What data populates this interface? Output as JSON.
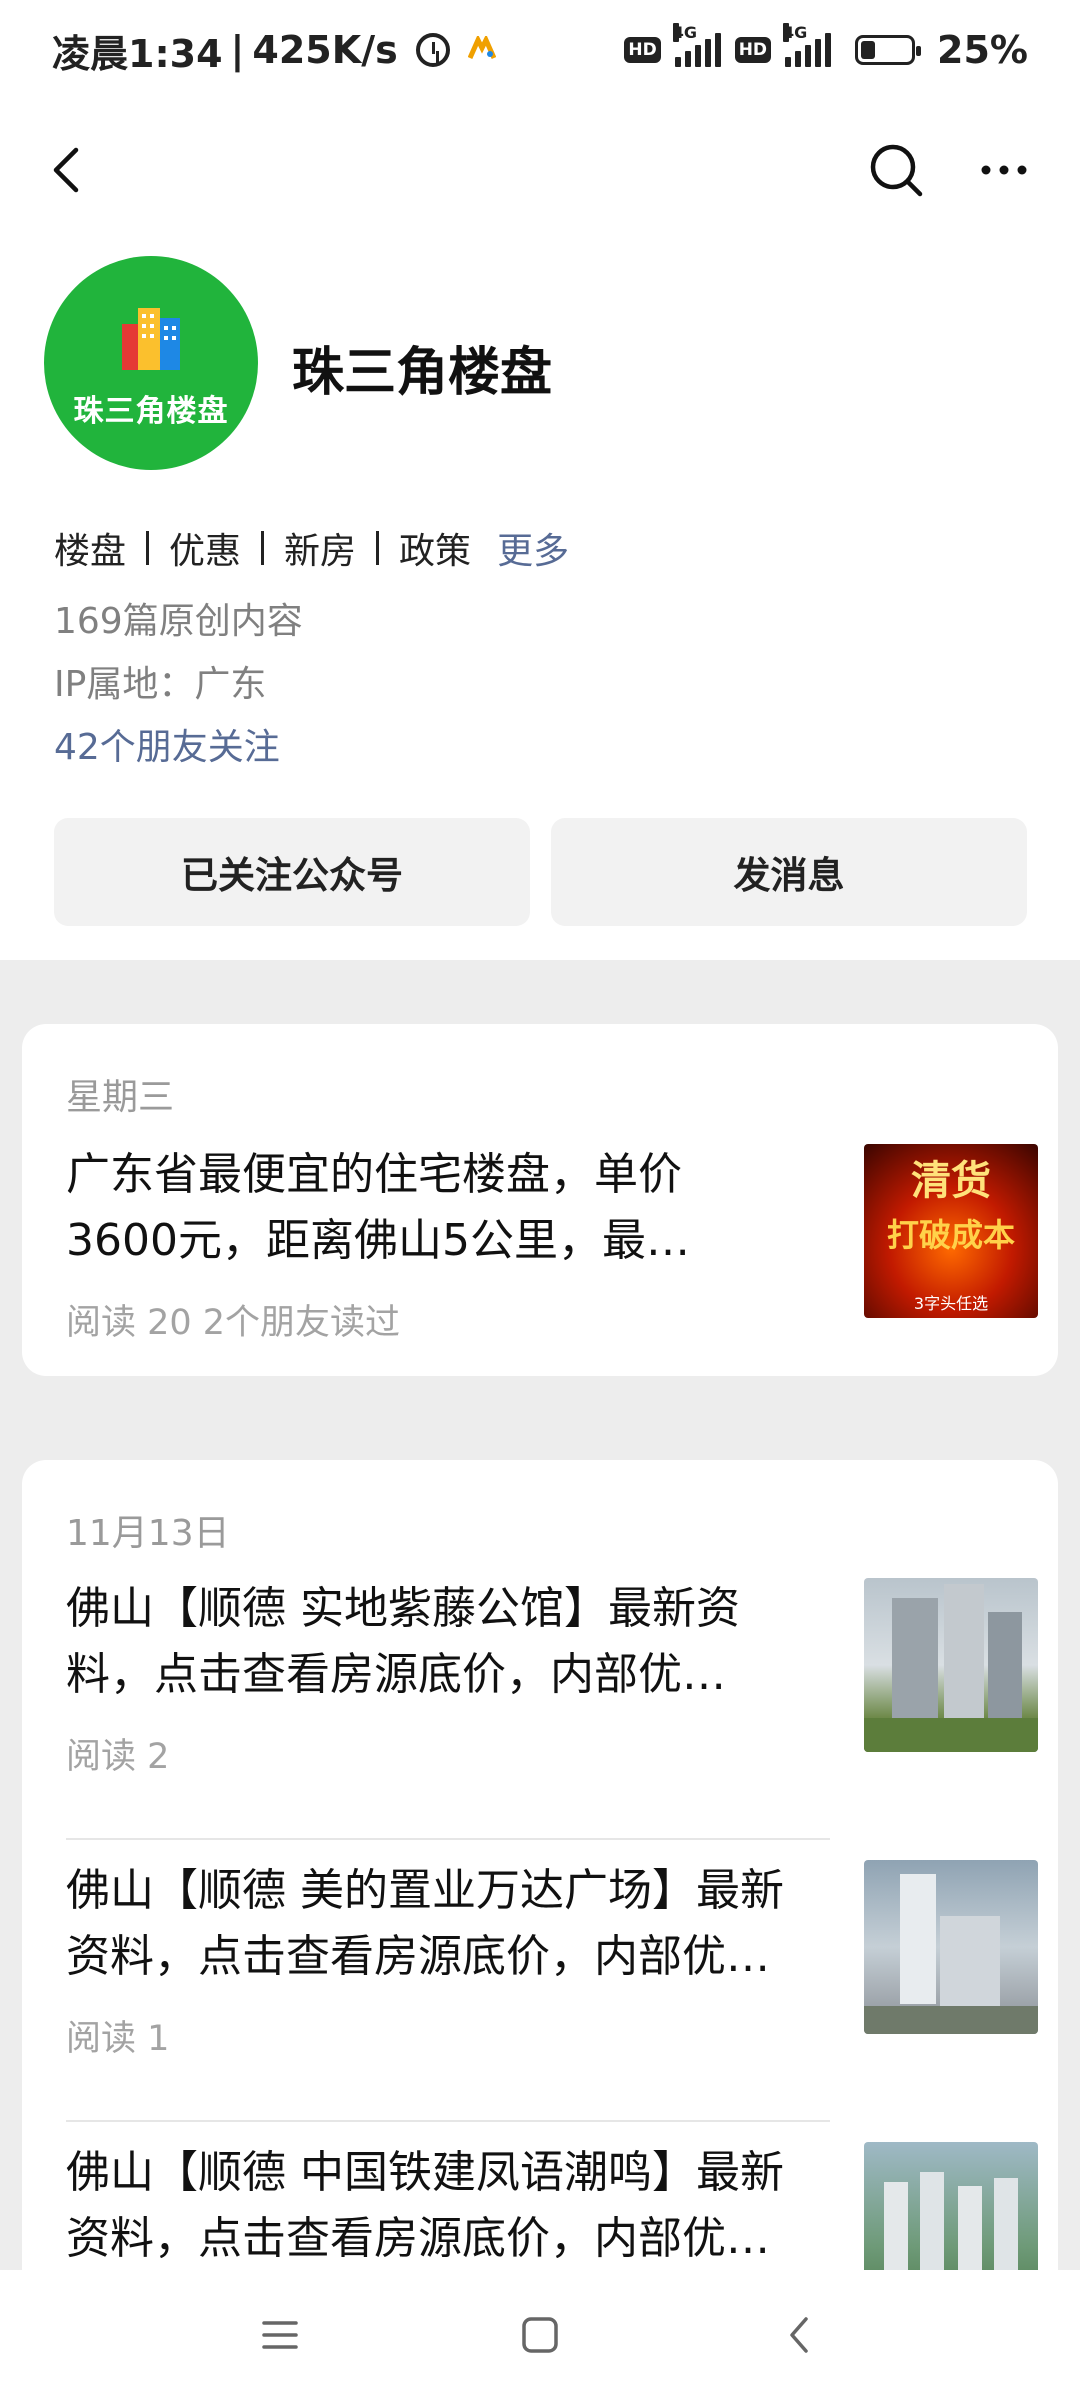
{
  "status_bar": {
    "time": "凌晨1:34",
    "speed": "425K/s",
    "network_1": "4G",
    "network_2": "4G",
    "hd_1": "HD",
    "hd_2": "HD",
    "battery": "25%"
  },
  "navbar": {
    "back_icon": "chevron-left-icon",
    "search_icon": "search-icon",
    "more_icon": "more-dots-icon"
  },
  "account": {
    "name": "珠三角楼盘",
    "avatar_text": "珠三角楼盘",
    "avatar_color": "#21b43c",
    "tags": [
      "楼盘",
      "优惠",
      "新房",
      "政策"
    ],
    "more_label": "更多",
    "original_count": "169篇原创内容",
    "ip_location": "IP属地：广东",
    "friends_following": "42个朋友关注"
  },
  "actions": {
    "follow_label": "已关注公众号",
    "message_label": "发消息"
  },
  "feed": {
    "groups": [
      {
        "date": "星期三",
        "articles": [
          {
            "title": "广东省最便宜的住宅楼盘，单价3600元，距离佛山5公里，最…",
            "meta": "阅读 20   2个朋友读过",
            "thumb_text_1": "清货",
            "thumb_text_2": "打破成本",
            "thumb_text_3": "3字头任选"
          }
        ]
      },
      {
        "date": "11月13日",
        "articles": [
          {
            "title": "佛山【顺德 实地紫藤公馆】最新资料，点击查看房源底价，内部优…",
            "meta": "阅读 2"
          },
          {
            "title": "佛山【顺德 美的置业万达广场】最新资料，点击查看房源底价，内部优…",
            "meta": "阅读 1"
          },
          {
            "title": "佛山【顺德 中国铁建凤语潮鸣】最新资料，点击查看房源底价，内部优…",
            "meta": ""
          }
        ]
      }
    ]
  },
  "system_nav": {
    "menu_icon": "menu-icon",
    "home_icon": "home-square-icon",
    "back_icon": "back-triangle-icon"
  },
  "colors": {
    "link": "#576b95",
    "feed_bg": "#ededed",
    "button_bg": "#f2f2f2"
  }
}
